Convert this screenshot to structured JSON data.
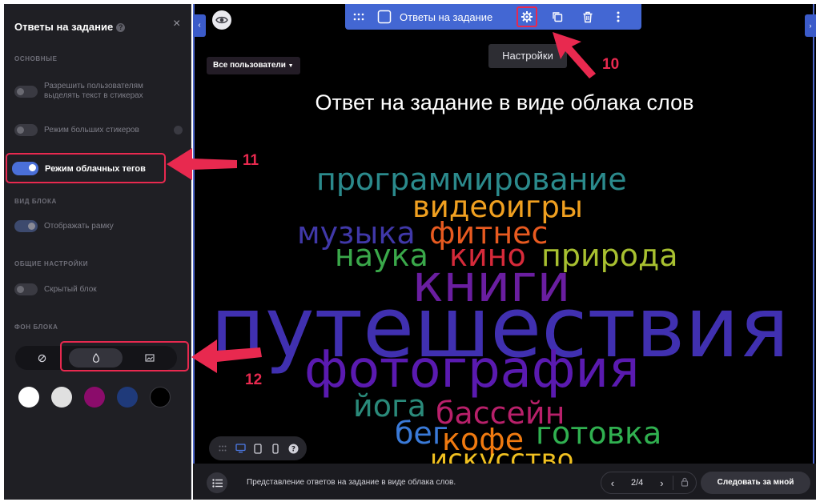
{
  "sidebar": {
    "title": "Ответы на задание",
    "close": "×",
    "sections": {
      "basic": "ОСНОВНЫЕ",
      "view": "ВИД БЛОКА",
      "general": "ОБЩИЕ НАСТРОЙКИ",
      "background": "ФОН БЛОКА"
    },
    "toggles": {
      "allow_highlight": {
        "label": "Разрешить пользователям выделять текст в стикерах",
        "on": false
      },
      "big_stickers": {
        "label": "Режим больших стикеров",
        "on": false
      },
      "cloud_tags": {
        "label": "Режим облачных тегов",
        "on": true
      },
      "show_frame": {
        "label": "Отображать рамку",
        "on": true
      },
      "hidden_block": {
        "label": "Скрытый блок",
        "on": false
      }
    },
    "background_modes": [
      "none-icon",
      "drop-icon",
      "image-icon"
    ],
    "active_background_mode": "drop-icon",
    "swatches": [
      "#ffffff",
      "#e0e0e0",
      "#8b0c6b",
      "#1f3a7a",
      "#000000"
    ]
  },
  "toolbar": {
    "title": "Ответы на задание",
    "tooltip": "Настройки"
  },
  "canvas": {
    "filter": "Все пользователи",
    "title": "Ответ на задание в виде облака слов",
    "words": [
      {
        "text": "программирование",
        "color": "#2b8a8c"
      },
      {
        "text": "видеоигры",
        "color": "#f0a020"
      },
      {
        "text": "музыка",
        "color": "#4038a8"
      },
      {
        "text": "фитнес",
        "color": "#e85a20"
      },
      {
        "text": "наука",
        "color": "#3aa84a"
      },
      {
        "text": "кино",
        "color": "#d62a3a"
      },
      {
        "text": "природа",
        "color": "#a8c030"
      },
      {
        "text": "книги",
        "color": "#6a1ea0"
      },
      {
        "text": "путешествия",
        "color": "#4030b0"
      },
      {
        "text": "фотография",
        "color": "#5a1ab0"
      },
      {
        "text": "йога",
        "color": "#2a8a7a"
      },
      {
        "text": "бассейн",
        "color": "#b8206a"
      },
      {
        "text": "бег",
        "color": "#3a7ad8"
      },
      {
        "text": "кофе",
        "color": "#f07a10"
      },
      {
        "text": "готовка",
        "color": "#30b050"
      },
      {
        "text": "искусство",
        "color": "#f0c020"
      }
    ]
  },
  "bottom": {
    "caption": "Представление ответов на задание в виде облака слов.",
    "page": "2/4",
    "follow": "Следовать за мной"
  },
  "annotations": {
    "n10": "10",
    "n11": "11",
    "n12": "12"
  }
}
